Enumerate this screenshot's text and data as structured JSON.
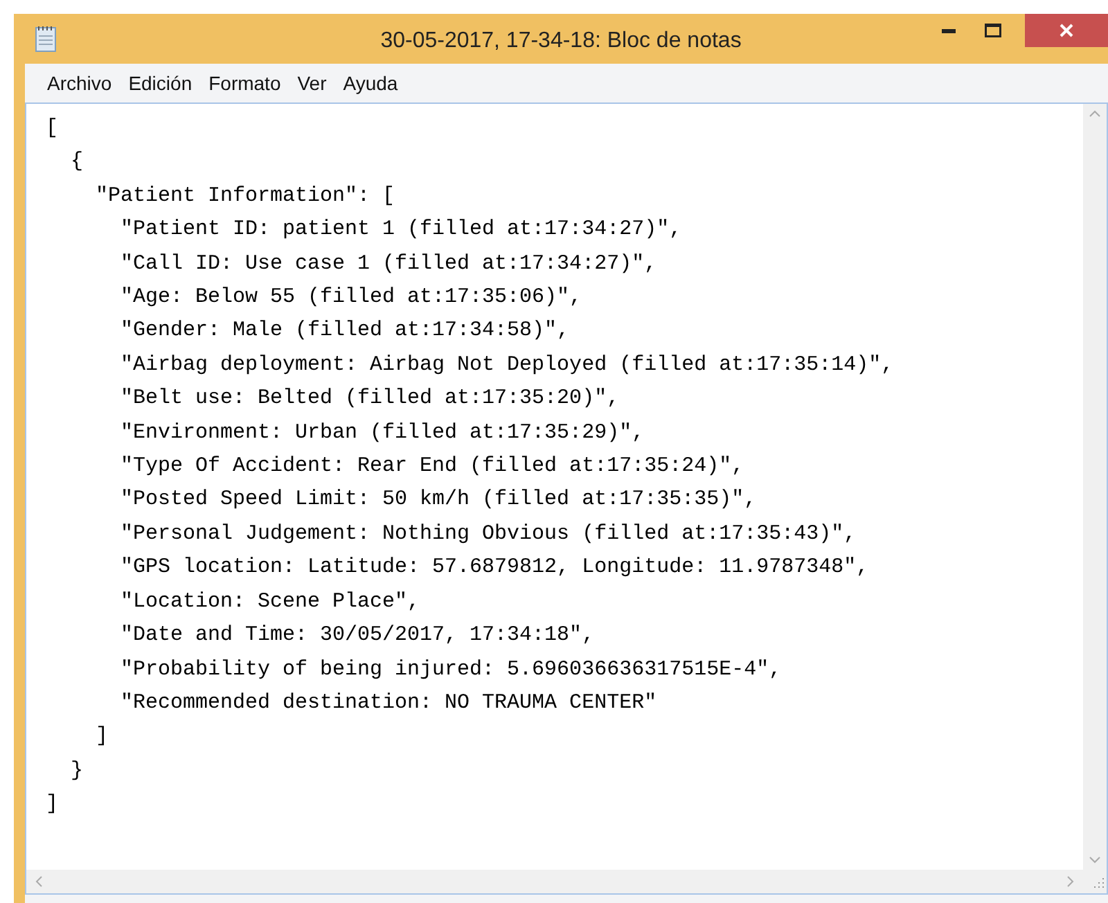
{
  "window": {
    "title": "30-05-2017, 17-34-18: Bloc de notas"
  },
  "menu": [
    "Archivo",
    "Edición",
    "Formato",
    "Ver",
    "Ayuda"
  ],
  "editor": {
    "lines": [
      "[",
      "  {",
      "    \"Patient Information\": [",
      "      \"Patient ID: patient 1 (filled at:17:34:27)\",",
      "      \"Call ID: Use case 1 (filled at:17:34:27)\",",
      "      \"Age: Below 55 (filled at:17:35:06)\",",
      "      \"Gender: Male (filled at:17:34:58)\",",
      "      \"Airbag deployment: Airbag Not Deployed (filled at:17:35:14)\",",
      "      \"Belt use: Belted (filled at:17:35:20)\",",
      "      \"Environment: Urban (filled at:17:35:29)\",",
      "      \"Type Of Accident: Rear End (filled at:17:35:24)\",",
      "      \"Posted Speed Limit: 50 km/h (filled at:17:35:35)\",",
      "      \"Personal Judgement: Nothing Obvious (filled at:17:35:43)\",",
      "      \"GPS location: Latitude: 57.6879812, Longitude: 11.9787348\",",
      "      \"Location: Scene Place\",",
      "      \"Date and Time: 30/05/2017, 17:34:18\",",
      "      \"Probability of being injured: 5.696036636317515E-4\",",
      "      \"Recommended destination: NO TRAUMA CENTER\"",
      "    ]",
      "  }",
      "]"
    ]
  }
}
